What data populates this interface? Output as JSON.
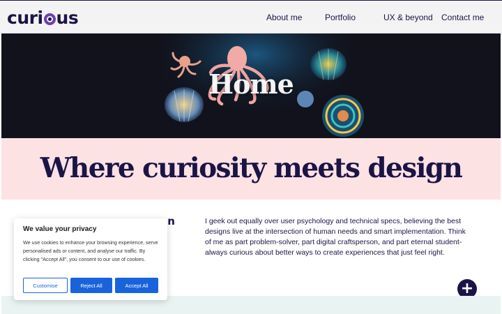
{
  "header": {
    "logo_text_pre": "curi",
    "logo_text_post": "us",
    "nav": [
      "About me",
      "Portfolio",
      "UX & beyond",
      "Contact me"
    ]
  },
  "hero": {
    "title": "Home"
  },
  "tagline": "Where curiosity meets design",
  "content": {
    "left_heading_line1": "",
    "left_heading_line2": "on",
    "body": "I geek out equally over user psychology and technical specs, believing the best designs live at the intersection of human needs and smart implementation. Think of me as part problem-solver, part digital craftsperson, and part eternal student- always curious about better ways to create experiences that just feel right."
  },
  "fab": {
    "symbol": "+"
  },
  "cookie": {
    "title": "We value your privacy",
    "text": "We use cookies to enhance your browsing experience, serve personalised ads or content, and analyse our traffic. By clicking \"Accept All\", you consent to our use of cookies.",
    "customise": "Customise",
    "reject": "Reject All",
    "accept": "Accept All"
  },
  "colors": {
    "navy": "#1b1446",
    "purple": "#6d3fb5",
    "pink": "#fde2e3",
    "blue": "#1863dc"
  }
}
